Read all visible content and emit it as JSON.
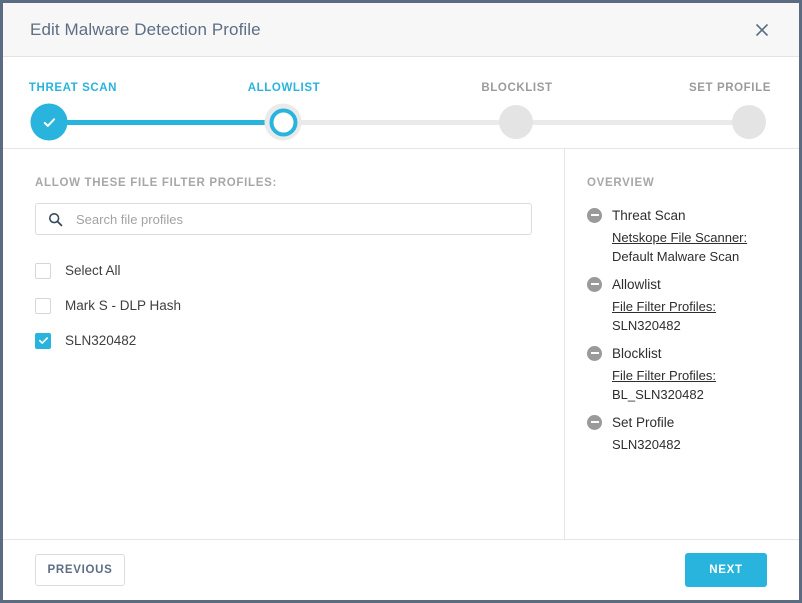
{
  "dialog": {
    "title": "Edit Malware Detection Profile",
    "close_icon": "close-icon",
    "accent_color": "#29b4dd",
    "muted_color": "#9b9b9b",
    "title_color": "#5d6e85"
  },
  "stepper": {
    "steps": [
      {
        "label": "THREAT SCAN",
        "state": "done"
      },
      {
        "label": "ALLOWLIST",
        "state": "current"
      },
      {
        "label": "BLOCKLIST",
        "state": "todo"
      },
      {
        "label": "SET PROFILE",
        "state": "todo"
      }
    ]
  },
  "left_panel": {
    "section_label": "ALLOW THESE FILE FILTER PROFILES:",
    "search": {
      "icon": "search-icon",
      "placeholder": "Search file profiles",
      "value": ""
    },
    "checkboxes": [
      {
        "label": "Select All",
        "checked": false
      },
      {
        "label": "Mark S - DLP Hash",
        "checked": false
      },
      {
        "label": "SLN320482",
        "checked": true
      }
    ]
  },
  "overview": {
    "heading": "OVERVIEW",
    "items": [
      {
        "title": "Threat Scan",
        "key": "Netskope File Scanner:",
        "value": "Default Malware Scan"
      },
      {
        "title": "Allowlist",
        "key": "File Filter Profiles:",
        "value": "SLN320482"
      },
      {
        "title": "Blocklist",
        "key": "File Filter Profiles:",
        "value": "BL_SLN320482"
      },
      {
        "title": "Set Profile",
        "key": "",
        "value": "SLN320482"
      }
    ]
  },
  "footer": {
    "previous_label": "PREVIOUS",
    "next_label": "NEXT"
  }
}
